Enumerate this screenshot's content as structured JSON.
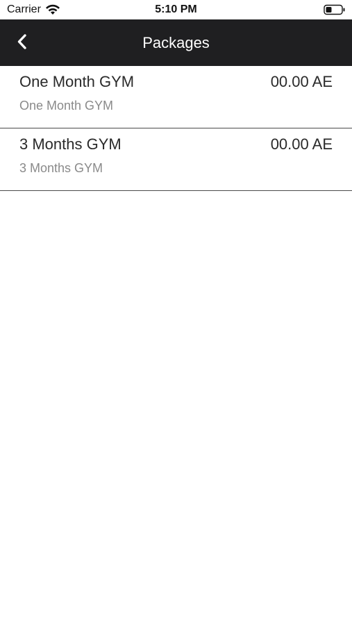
{
  "status_bar": {
    "carrier": "Carrier",
    "time": "5:10 PM",
    "wifi_icon": "wifi-icon",
    "battery_icon": "battery-icon"
  },
  "nav": {
    "title": "Packages",
    "back_icon": "chevron-left-icon",
    "background_color": "#1f1f21"
  },
  "packages": [
    {
      "name": "One Month GYM",
      "description": "One Month GYM",
      "price": "00.00 AE"
    },
    {
      "name": "3 Months GYM",
      "description": "3 Months GYM",
      "price": "00.00 AE"
    }
  ]
}
